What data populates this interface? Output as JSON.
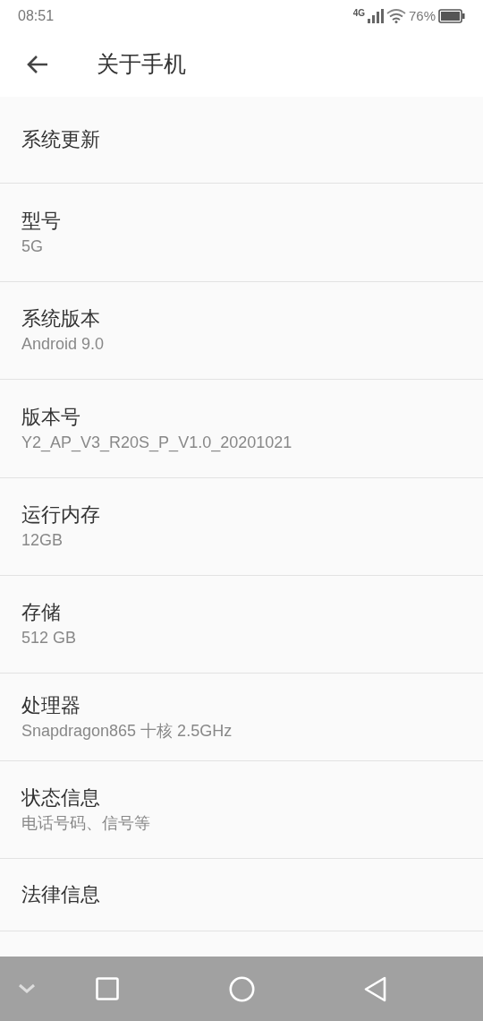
{
  "status_bar": {
    "time": "08:51",
    "network": "4G",
    "battery": "76%"
  },
  "header": {
    "title": "关于手机"
  },
  "items": [
    {
      "title": "系统更新"
    },
    {
      "title": "型号",
      "subtitle": "5G"
    },
    {
      "title": "系统版本",
      "subtitle": "Android 9.0"
    },
    {
      "title": "版本号",
      "subtitle": "Y2_AP_V3_R20S_P_V1.0_20201021"
    },
    {
      "title": "运行内存",
      "subtitle": "12GB"
    },
    {
      "title": "存储",
      "subtitle": "512 GB"
    },
    {
      "title": "处理器",
      "subtitle": "Snapdragon865 十核 2.5GHz"
    },
    {
      "title": "状态信息",
      "subtitle": "电话号码、信号等"
    },
    {
      "title": "法律信息"
    }
  ]
}
